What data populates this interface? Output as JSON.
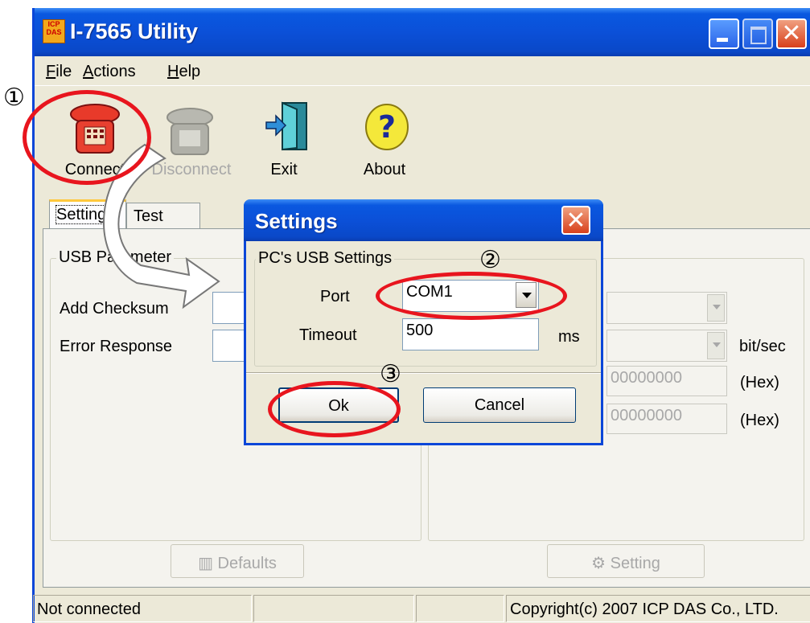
{
  "window": {
    "title": "I-7565 Utility",
    "icon_text": "ICP DAS"
  },
  "menu": {
    "file": "File",
    "actions": "Actions",
    "help": "Help"
  },
  "toolbar": {
    "connect": "Connect",
    "disconnect": "Disconnect",
    "exit": "Exit",
    "about": "About"
  },
  "tabs": {
    "setting": "Setting",
    "test": "Test"
  },
  "usb_group": {
    "title": "USB Parameter",
    "add_checksum_label": "Add Checksum",
    "error_response_label": "Error Response"
  },
  "right_group": {
    "baud_unit": "bit/sec",
    "hex_value_1": "00000000",
    "hex_value_2": "00000000",
    "hex_unit_1": "(Hex)",
    "hex_unit_2": "(Hex)"
  },
  "buttons": {
    "defaults": "Defaults",
    "setting": "Setting"
  },
  "status": {
    "connection": "Not connected",
    "copyright": "Copyright(c) 2007 ICP DAS Co., LTD."
  },
  "dialog": {
    "title": "Settings",
    "group_title": "PC's USB Settings",
    "port_label": "Port",
    "port_value": "COM1",
    "timeout_label": "Timeout",
    "timeout_value": "500",
    "timeout_unit": "ms",
    "ok_label": "Ok",
    "cancel_label": "Cancel"
  },
  "annotations": {
    "step1": "①",
    "step2": "②",
    "step3": "③"
  },
  "colors": {
    "highlight_ring": "#e8151e",
    "titlebar": "#0a50d8"
  }
}
